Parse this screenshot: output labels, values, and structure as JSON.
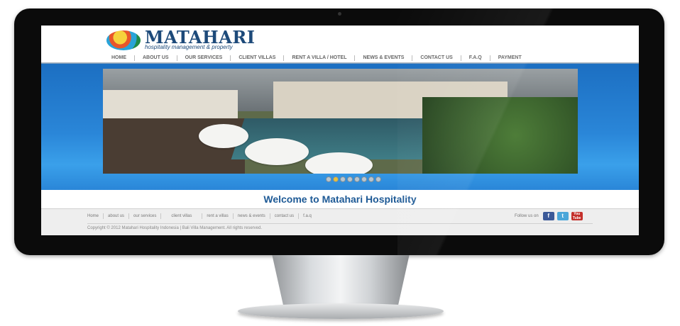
{
  "brand": {
    "name": "MATAHARI",
    "tagline": "hospitality management & property"
  },
  "nav": {
    "items": [
      "HOME",
      "ABOUT US",
      "OUR SERVICES",
      "CLIENT VILLAS",
      "RENT A VILLA / HOTEL",
      "NEWS & EVENTS",
      "CONTACT US",
      "F.A.Q",
      "PAYMENT"
    ]
  },
  "slider": {
    "active_index": 1,
    "count": 8
  },
  "welcome": {
    "title": "Welcome to Matahari Hospitality"
  },
  "footer": {
    "links": [
      "Home",
      "about us",
      "our services",
      "client villas",
      "rent a villas",
      "news & events",
      "contact us",
      "f.a.q"
    ],
    "follow_label": "Follow us on",
    "social": [
      {
        "name": "facebook-icon",
        "glyph": "f"
      },
      {
        "name": "twitter-icon",
        "glyph": "t"
      },
      {
        "name": "youtube-icon",
        "glyph": "You Tube"
      }
    ],
    "copyright": "Copyright © 2012 Matahari Hospitality Indonesia | Bali Villa Management. All rights reserved."
  },
  "colors": {
    "brand_blue": "#1d4a7a",
    "banner_blue": "#2a86d8",
    "welcome_text": "#1e5a96"
  }
}
